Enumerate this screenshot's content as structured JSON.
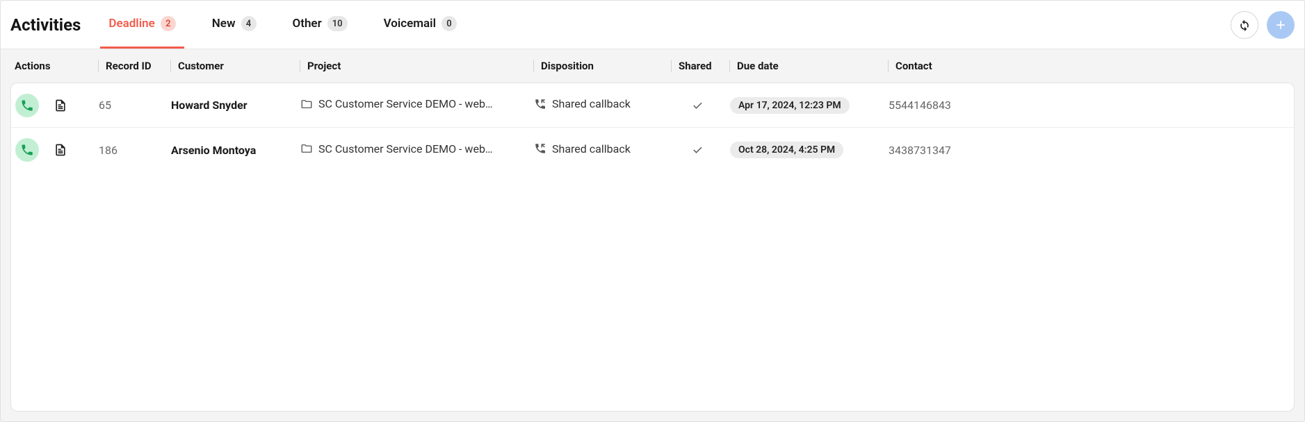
{
  "header": {
    "title": "Activities",
    "tabs": [
      {
        "label": "Deadline",
        "count": "2",
        "active": true
      },
      {
        "label": "New",
        "count": "4",
        "active": false
      },
      {
        "label": "Other",
        "count": "10",
        "active": false
      },
      {
        "label": "Voicemail",
        "count": "0",
        "active": false
      }
    ]
  },
  "columns": {
    "actions": "Actions",
    "record": "Record ID",
    "customer": "Customer",
    "project": "Project",
    "disposition": "Disposition",
    "shared": "Shared",
    "due": "Due date",
    "contact": "Contact"
  },
  "rows": [
    {
      "record_id": "65",
      "customer": "Howard Snyder",
      "project": "SC Customer Service DEMO - web…",
      "disposition": "Shared callback",
      "shared": true,
      "due": "Apr 17, 2024, 12:23 PM",
      "contact": "5544146843"
    },
    {
      "record_id": "186",
      "customer": "Arsenio Montoya",
      "project": "SC Customer Service DEMO - web…",
      "disposition": "Shared callback",
      "shared": true,
      "due": "Oct 28, 2024, 4:25 PM",
      "contact": "3438731347"
    }
  ]
}
